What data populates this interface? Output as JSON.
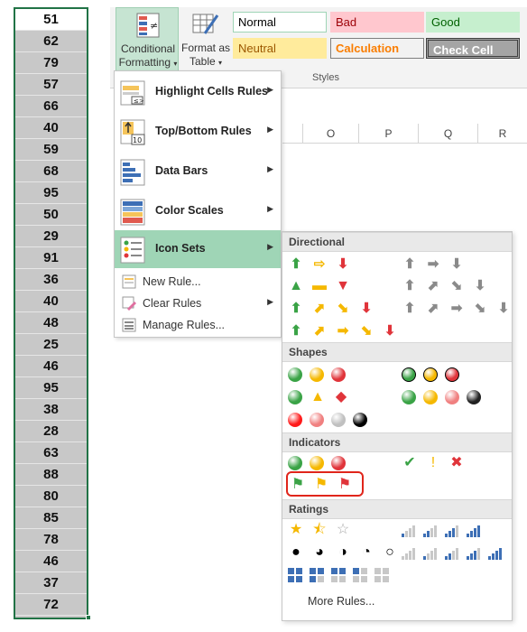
{
  "column_values": [
    "51",
    "62",
    "79",
    "57",
    "66",
    "40",
    "59",
    "68",
    "95",
    "50",
    "29",
    "91",
    "36",
    "40",
    "48",
    "25",
    "46",
    "95",
    "38",
    "28",
    "63",
    "88",
    "80",
    "85",
    "78",
    "46",
    "37",
    "72"
  ],
  "ribbon": {
    "conditional_formatting": {
      "line1": "Conditional",
      "line2": "Formatting",
      "caret": "▾"
    },
    "format_as_table": {
      "line1": "Format as",
      "line2": "Table",
      "caret": "▾"
    },
    "styles": [
      {
        "label": "Normal",
        "bg": "#ffffff",
        "fg": "#000000",
        "border": "#9fd5b6"
      },
      {
        "label": "Bad",
        "bg": "#ffc7ce",
        "fg": "#9c0006",
        "border": "#ffc7ce"
      },
      {
        "label": "Good",
        "bg": "#c6efce",
        "fg": "#006100",
        "border": "#c6efce"
      },
      {
        "label": "Neutral",
        "bg": "#ffeb9c",
        "fg": "#9c5700",
        "border": "#ffeb9c"
      },
      {
        "label": "Calculation",
        "bg": "#f2f2f2",
        "fg": "#fa7d00",
        "border": "#7f7f7f"
      },
      {
        "label": "Check Cell",
        "bg": "#a5a5a5",
        "fg": "#ffffff",
        "border": "#3f3f3f"
      }
    ],
    "styles_caption": "Styles"
  },
  "column_headers": [
    "O",
    "P",
    "Q",
    "R"
  ],
  "menu": {
    "items": [
      {
        "label": "Highlight Cells Rules",
        "arrow": "▶"
      },
      {
        "label": "Top/Bottom Rules",
        "arrow": "▶"
      },
      {
        "label": "Data Bars",
        "arrow": "▶"
      },
      {
        "label": "Color Scales",
        "arrow": "▶"
      },
      {
        "label": "Icon Sets",
        "arrow": "▶"
      }
    ],
    "small_items": [
      {
        "label": "New Rule..."
      },
      {
        "label": "Clear Rules",
        "arrow": "▶"
      },
      {
        "label": "Manage Rules..."
      }
    ]
  },
  "submenu": {
    "headers": [
      "Directional",
      "Shapes",
      "Indicators",
      "Ratings"
    ],
    "more_rules": "More Rules...",
    "colors": {
      "green": "#3aa346",
      "yellow": "#f5b800",
      "red": "#e0343a",
      "gray": "#8a8a8a",
      "black": "#000000",
      "blue": "#3d6fb5",
      "highlight": "#e0251b"
    }
  }
}
